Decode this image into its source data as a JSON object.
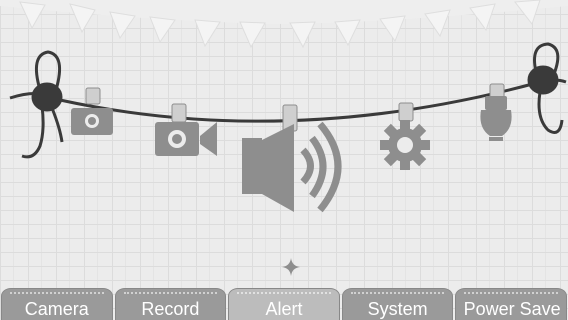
{
  "colors": {
    "background": "#ececec",
    "icon": "#8e8e8e",
    "string": "#3a3a3a",
    "tab": "#9a9a9a",
    "tab_active": "#bcbcbc",
    "tab_text": "#ffffff"
  },
  "icons": [
    "camera-icon",
    "record-icon",
    "alert-speaker-icon",
    "system-gear-icon",
    "power-save-bulb-icon"
  ],
  "tabs": [
    {
      "label": "Camera",
      "active": false
    },
    {
      "label": "Record",
      "active": false
    },
    {
      "label": "Alert",
      "active": true
    },
    {
      "label": "System",
      "active": false
    },
    {
      "label": "Power Save",
      "active": false
    }
  ],
  "selected_tab": "Alert"
}
